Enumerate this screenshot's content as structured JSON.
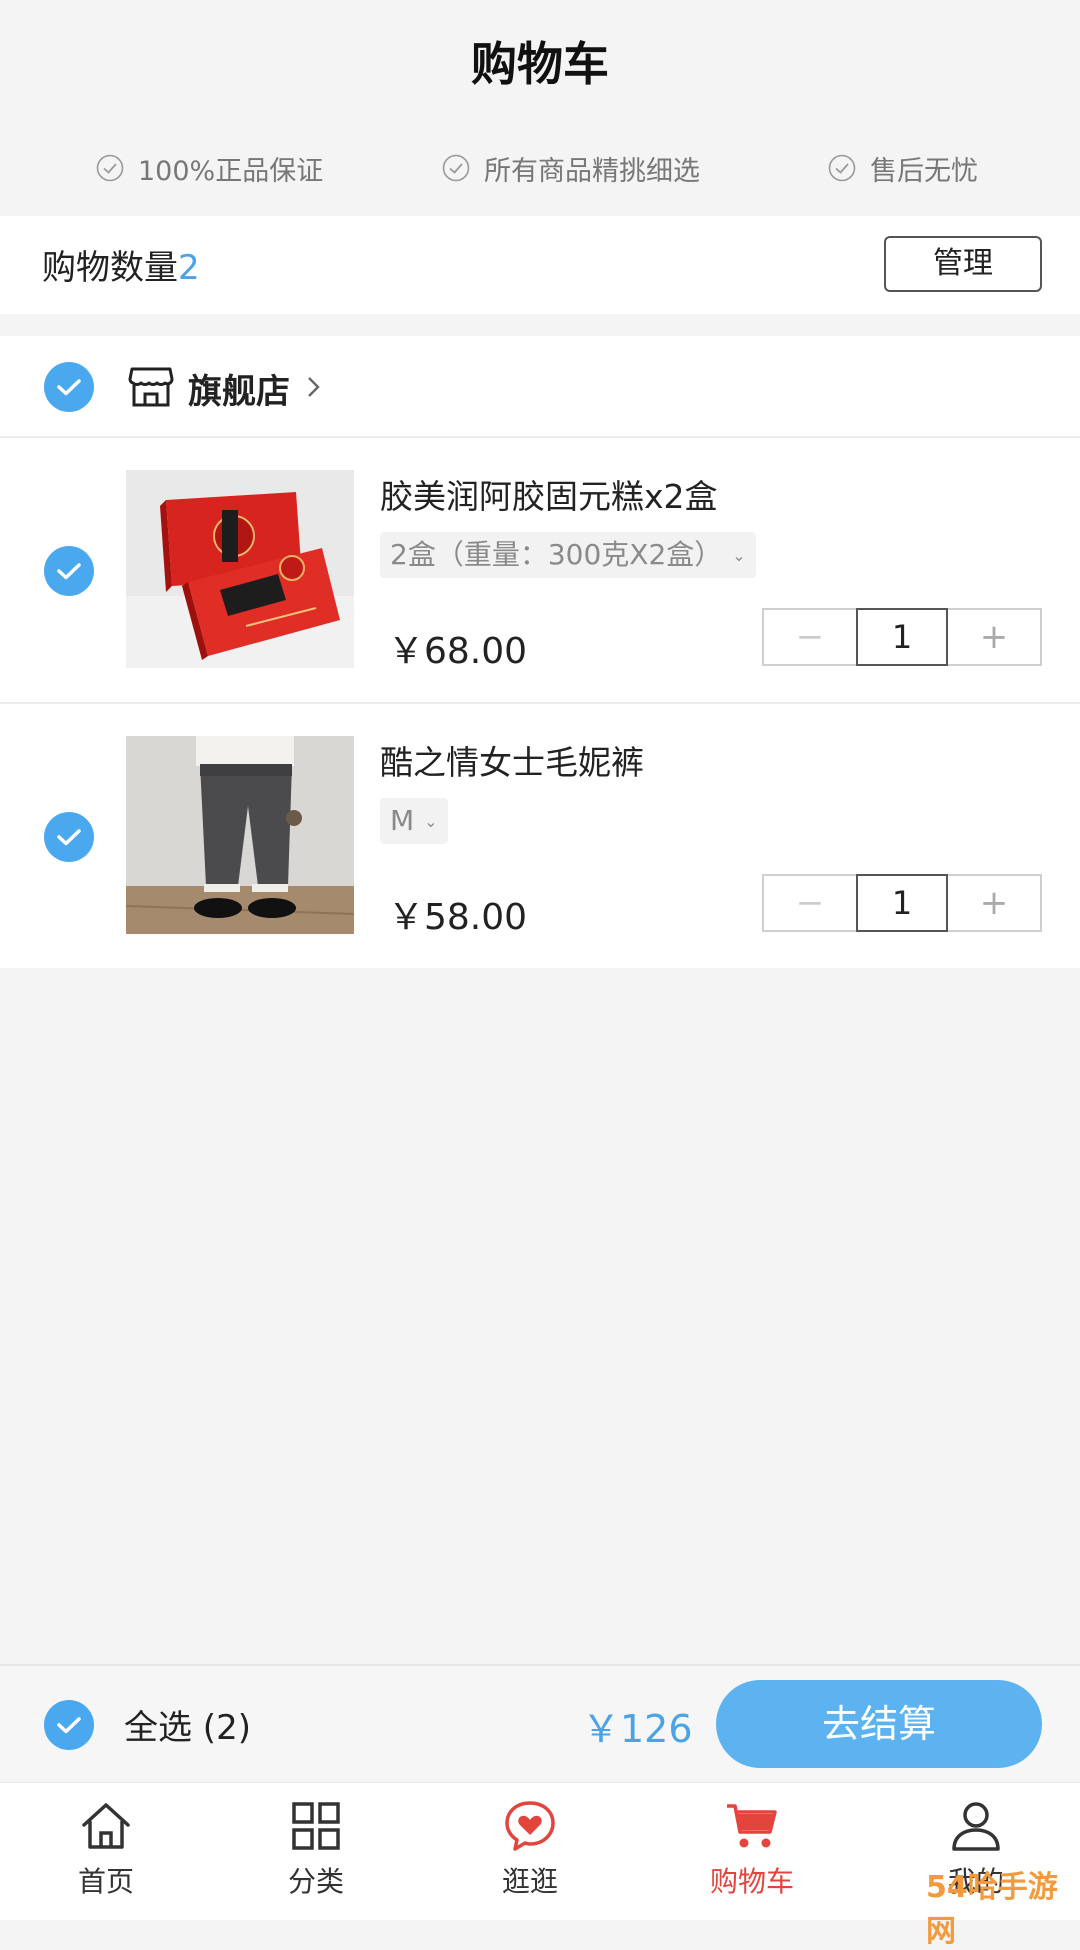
{
  "header": {
    "title": "购物车",
    "guarantees": [
      "100%正品保证",
      "所有商品精挑细选",
      "售后无忧"
    ]
  },
  "summary": {
    "count_label": "购物数量",
    "count_value": "2",
    "manage_label": "管理"
  },
  "store": {
    "name": "旗舰店",
    "checked": true
  },
  "items": [
    {
      "name": "胶美润阿胶固元糕x2盒",
      "variant": "2盒（重量：300克X2盒）",
      "price": "￥68.00",
      "quantity": "1",
      "checked": true,
      "image": "red-gift-box-photo"
    },
    {
      "name": "酷之情女士毛妮裤",
      "variant": "M",
      "price": "￥58.00",
      "quantity": "1",
      "checked": true,
      "image": "grey-trousers-photo"
    }
  ],
  "stepper": {
    "minus": "−",
    "plus": "+"
  },
  "checkout": {
    "select_all_label": "全选 (2)",
    "total": "￥126",
    "pay_label": "去结算"
  },
  "tabbar": [
    {
      "label": "首页",
      "icon": "home-icon",
      "active": false
    },
    {
      "label": "分类",
      "icon": "grid-icon",
      "active": false
    },
    {
      "label": "逛逛",
      "icon": "heart-bubble-icon",
      "active": false
    },
    {
      "label": "购物车",
      "icon": "cart-icon",
      "active": true
    },
    {
      "label": "我的",
      "icon": "user-icon",
      "active": false
    }
  ],
  "watermark": "54哈手游网",
  "colors": {
    "accent_blue": "#4aa9ee",
    "pay_button": "#5db3ef",
    "active_tab_red": "#e3453d",
    "background": "#f4f4f4"
  }
}
